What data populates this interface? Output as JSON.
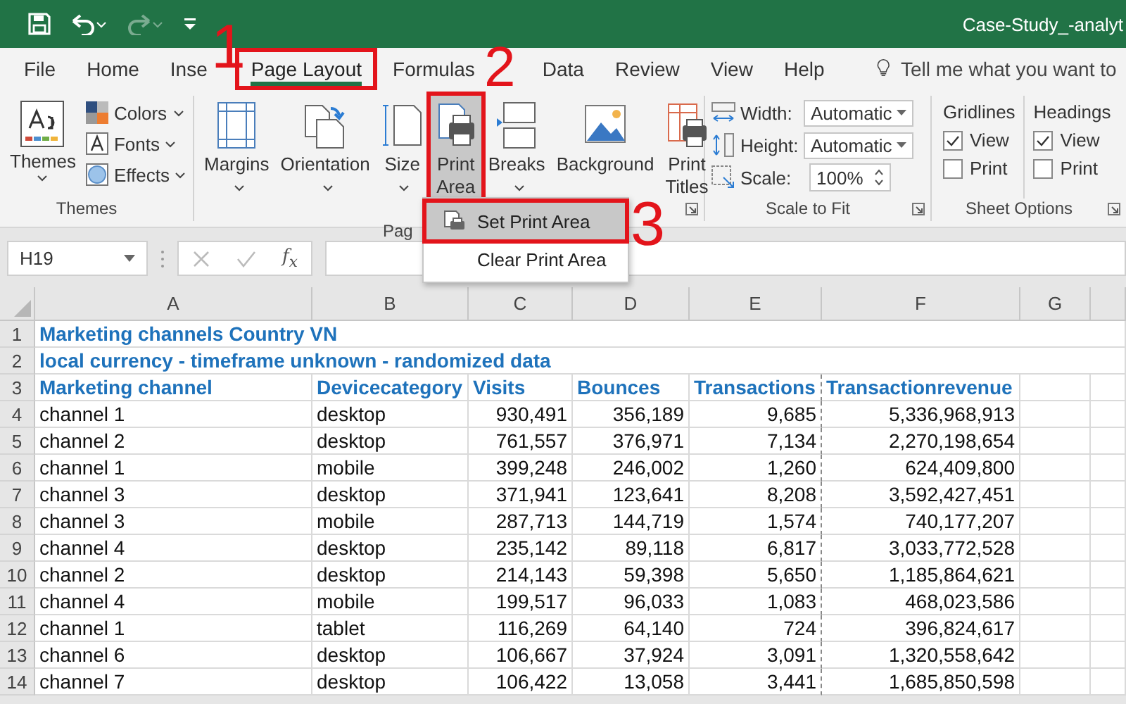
{
  "window": {
    "title": "Case-Study_-analyt",
    "redo_disabled": true
  },
  "tabs": [
    {
      "label": "File",
      "selected": false,
      "highlighted": false
    },
    {
      "label": "Home",
      "selected": false,
      "highlighted": false
    },
    {
      "label": "Inse",
      "selected": false,
      "highlighted": false
    },
    {
      "label": "Page Layout",
      "selected": true,
      "highlighted": true
    },
    {
      "label": "Formulas",
      "selected": false,
      "highlighted": false
    },
    {
      "label": "Data",
      "selected": false,
      "highlighted": false
    },
    {
      "label": "Review",
      "selected": false,
      "highlighted": false
    },
    {
      "label": "View",
      "selected": false,
      "highlighted": false
    },
    {
      "label": "Help",
      "selected": false,
      "highlighted": false
    }
  ],
  "tell_me": {
    "placeholder": "Tell me what you want to"
  },
  "ribbon": {
    "themes": {
      "label": "Themes",
      "button": {
        "label": "Themes",
        "dropdown": true
      },
      "small": [
        {
          "label": "Colors",
          "dropdown": true
        },
        {
          "label": "Fonts",
          "dropdown": true
        },
        {
          "label": "Effects",
          "dropdown": true
        }
      ]
    },
    "page_setup": {
      "label": "Pag",
      "buttons": [
        {
          "label": "Margins",
          "dropdown": true,
          "pressed": false,
          "highlighted": false
        },
        {
          "label": "Orientation",
          "dropdown": true,
          "pressed": false,
          "highlighted": false
        },
        {
          "label": "Size",
          "dropdown": true,
          "pressed": false,
          "highlighted": false
        },
        {
          "label": "Print Area",
          "dropdown": true,
          "pressed": true,
          "highlighted": true
        },
        {
          "label": "Breaks",
          "dropdown": true,
          "pressed": false,
          "highlighted": false
        },
        {
          "label": "Background",
          "dropdown": false,
          "pressed": false,
          "highlighted": false
        },
        {
          "label": "Print Titles",
          "dropdown": false,
          "pressed": false,
          "highlighted": false
        }
      ]
    },
    "scale_to_fit": {
      "label": "Scale to Fit",
      "width": {
        "label": "Width:",
        "value": "Automatic"
      },
      "height": {
        "label": "Height:",
        "value": "Automatic"
      },
      "scale": {
        "label": "Scale:",
        "value": "100%"
      }
    },
    "sheet_options": {
      "label": "Sheet Options",
      "columns": [
        {
          "label": "Gridlines",
          "options": [
            {
              "label": "View",
              "checked": true
            },
            {
              "label": "Print",
              "checked": false
            }
          ]
        },
        {
          "label": "Headings",
          "options": [
            {
              "label": "View",
              "checked": true
            },
            {
              "label": "Print",
              "checked": false
            }
          ]
        }
      ]
    }
  },
  "menu": {
    "items": [
      {
        "label": "Set Print Area",
        "selected": true,
        "highlighted": true
      },
      {
        "label": "Clear Print Area",
        "selected": false,
        "highlighted": false
      }
    ]
  },
  "annotations": [
    {
      "number": "1"
    },
    {
      "number": "2"
    },
    {
      "number": "3"
    }
  ],
  "formula_bar": {
    "name_box": "H19",
    "function_label": "f$_{x}$"
  },
  "sheet": {
    "columns": [
      "A",
      "B",
      "C",
      "D",
      "E",
      "F",
      "G"
    ],
    "rows": [
      {
        "number": "1",
        "kind": "title",
        "cells": [
          "Marketing channels Country VN"
        ]
      },
      {
        "number": "2",
        "kind": "title",
        "cells": [
          "local currency - timeframe unknown - randomized data"
        ]
      },
      {
        "number": "3",
        "kind": "header",
        "cells": [
          "Marketing channel",
          "Devicecategory",
          "Visits",
          "Bounces",
          "Transactions",
          "Transactionrevenue"
        ]
      },
      {
        "number": "4",
        "kind": "data",
        "cells": [
          "channel 1",
          "desktop",
          "930,491",
          "356,189",
          "9,685",
          "5,336,968,913"
        ]
      },
      {
        "number": "5",
        "kind": "data",
        "cells": [
          "channel 2",
          "desktop",
          "761,557",
          "376,971",
          "7,134",
          "2,270,198,654"
        ]
      },
      {
        "number": "6",
        "kind": "data",
        "cells": [
          "channel 1",
          "mobile",
          "399,248",
          "246,002",
          "1,260",
          "624,409,800"
        ]
      },
      {
        "number": "7",
        "kind": "data",
        "cells": [
          "channel 3",
          "desktop",
          "371,941",
          "123,641",
          "8,208",
          "3,592,427,451"
        ]
      },
      {
        "number": "8",
        "kind": "data",
        "cells": [
          "channel 3",
          "mobile",
          "287,713",
          "144,719",
          "1,574",
          "740,177,207"
        ]
      },
      {
        "number": "9",
        "kind": "data",
        "cells": [
          "channel 4",
          "desktop",
          "235,142",
          "89,118",
          "6,817",
          "3,033,772,528"
        ]
      },
      {
        "number": "10",
        "kind": "data",
        "cells": [
          "channel 2",
          "desktop",
          "214,143",
          "59,398",
          "5,650",
          "1,185,864,621"
        ]
      },
      {
        "number": "11",
        "kind": "data",
        "cells": [
          "channel 4",
          "mobile",
          "199,517",
          "96,033",
          "1,083",
          "468,023,586"
        ]
      },
      {
        "number": "12",
        "kind": "data",
        "cells": [
          "channel 1",
          "tablet",
          "116,269",
          "64,140",
          "724",
          "396,824,617"
        ]
      },
      {
        "number": "13",
        "kind": "data",
        "cells": [
          "channel 6",
          "desktop",
          "106,667",
          "37,924",
          "3,091",
          "1,320,558,642"
        ]
      },
      {
        "number": "14",
        "kind": "data",
        "cells": [
          "channel 7",
          "desktop",
          "106,422",
          "13,058",
          "3,441",
          "1,685,850,598"
        ]
      }
    ]
  }
}
